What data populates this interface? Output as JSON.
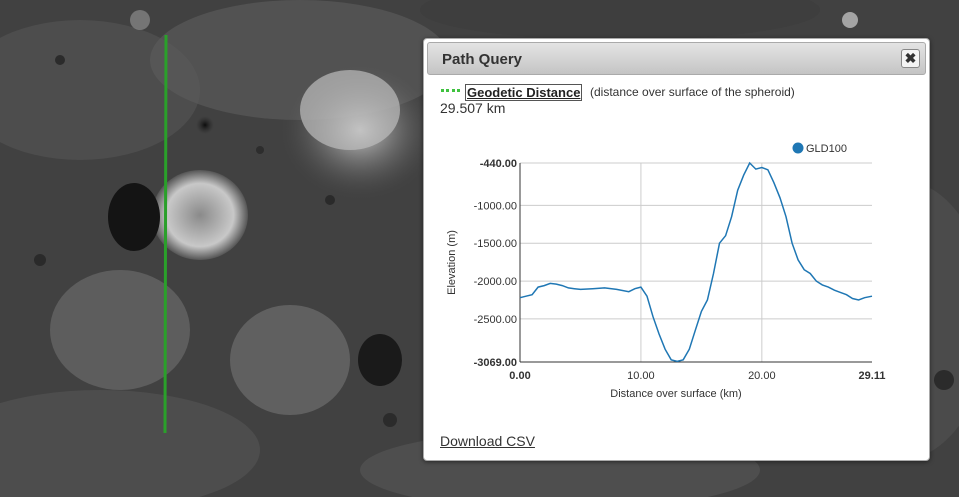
{
  "map": {
    "background_color": "#3a3a3a",
    "path_line_color": "#2aa02a"
  },
  "panel": {
    "title": "Path Query",
    "close_icon": "close-icon",
    "geodetic_label": "Geodetic Distance",
    "geodetic_description": "(distance over surface of the spheroid)",
    "distance_value": "29.507 km",
    "download_label": "Download CSV",
    "legend_line_color": "#3fc23f"
  },
  "chart_data": {
    "type": "line",
    "xlabel": "Distance over surface (km)",
    "ylabel": "Elevation (m)",
    "xlim": [
      0,
      29.11
    ],
    "ylim": [
      -3069,
      -440
    ],
    "x_ticks": [
      "0.00",
      "10.00",
      "20.00",
      "29.11"
    ],
    "x_tick_values": [
      0,
      10,
      20,
      29.11
    ],
    "y_ticks": [
      "-440.00",
      "-1000.00",
      "-1500.00",
      "-2000.00",
      "-2500.00",
      "-3069.00"
    ],
    "y_tick_values": [
      -440,
      -1000,
      -1500,
      -2000,
      -2500,
      -3069
    ],
    "grid": true,
    "legend_position": "top-right",
    "series": [
      {
        "name": "GLD100",
        "color": "#1f77b4",
        "x": [
          0,
          0.5,
          1,
          1.5,
          2,
          2.5,
          3,
          3.5,
          4,
          4.5,
          5,
          6,
          7,
          8,
          9,
          9.5,
          10,
          10.5,
          11,
          11.5,
          12,
          12.5,
          13,
          13.5,
          14,
          14.5,
          15,
          15.5,
          16,
          16.5,
          17,
          17.5,
          18,
          18.5,
          19,
          19.5,
          20,
          20.5,
          21,
          21.5,
          22,
          22.5,
          23,
          23.5,
          24,
          24.5,
          25,
          25.5,
          26,
          26.5,
          27,
          27.5,
          28,
          28.5,
          29.11
        ],
        "y": [
          -2220,
          -2200,
          -2180,
          -2080,
          -2060,
          -2030,
          -2040,
          -2060,
          -2090,
          -2100,
          -2110,
          -2100,
          -2090,
          -2110,
          -2140,
          -2100,
          -2080,
          -2200,
          -2470,
          -2700,
          -2900,
          -3040,
          -3060,
          -3040,
          -2900,
          -2650,
          -2400,
          -2250,
          -1900,
          -1500,
          -1400,
          -1150,
          -800,
          -600,
          -440,
          -520,
          -500,
          -530,
          -700,
          -900,
          -1150,
          -1500,
          -1720,
          -1850,
          -1900,
          -2000,
          -2050,
          -2080,
          -2120,
          -2150,
          -2180,
          -2230,
          -2250,
          -2220,
          -2200
        ]
      }
    ]
  }
}
